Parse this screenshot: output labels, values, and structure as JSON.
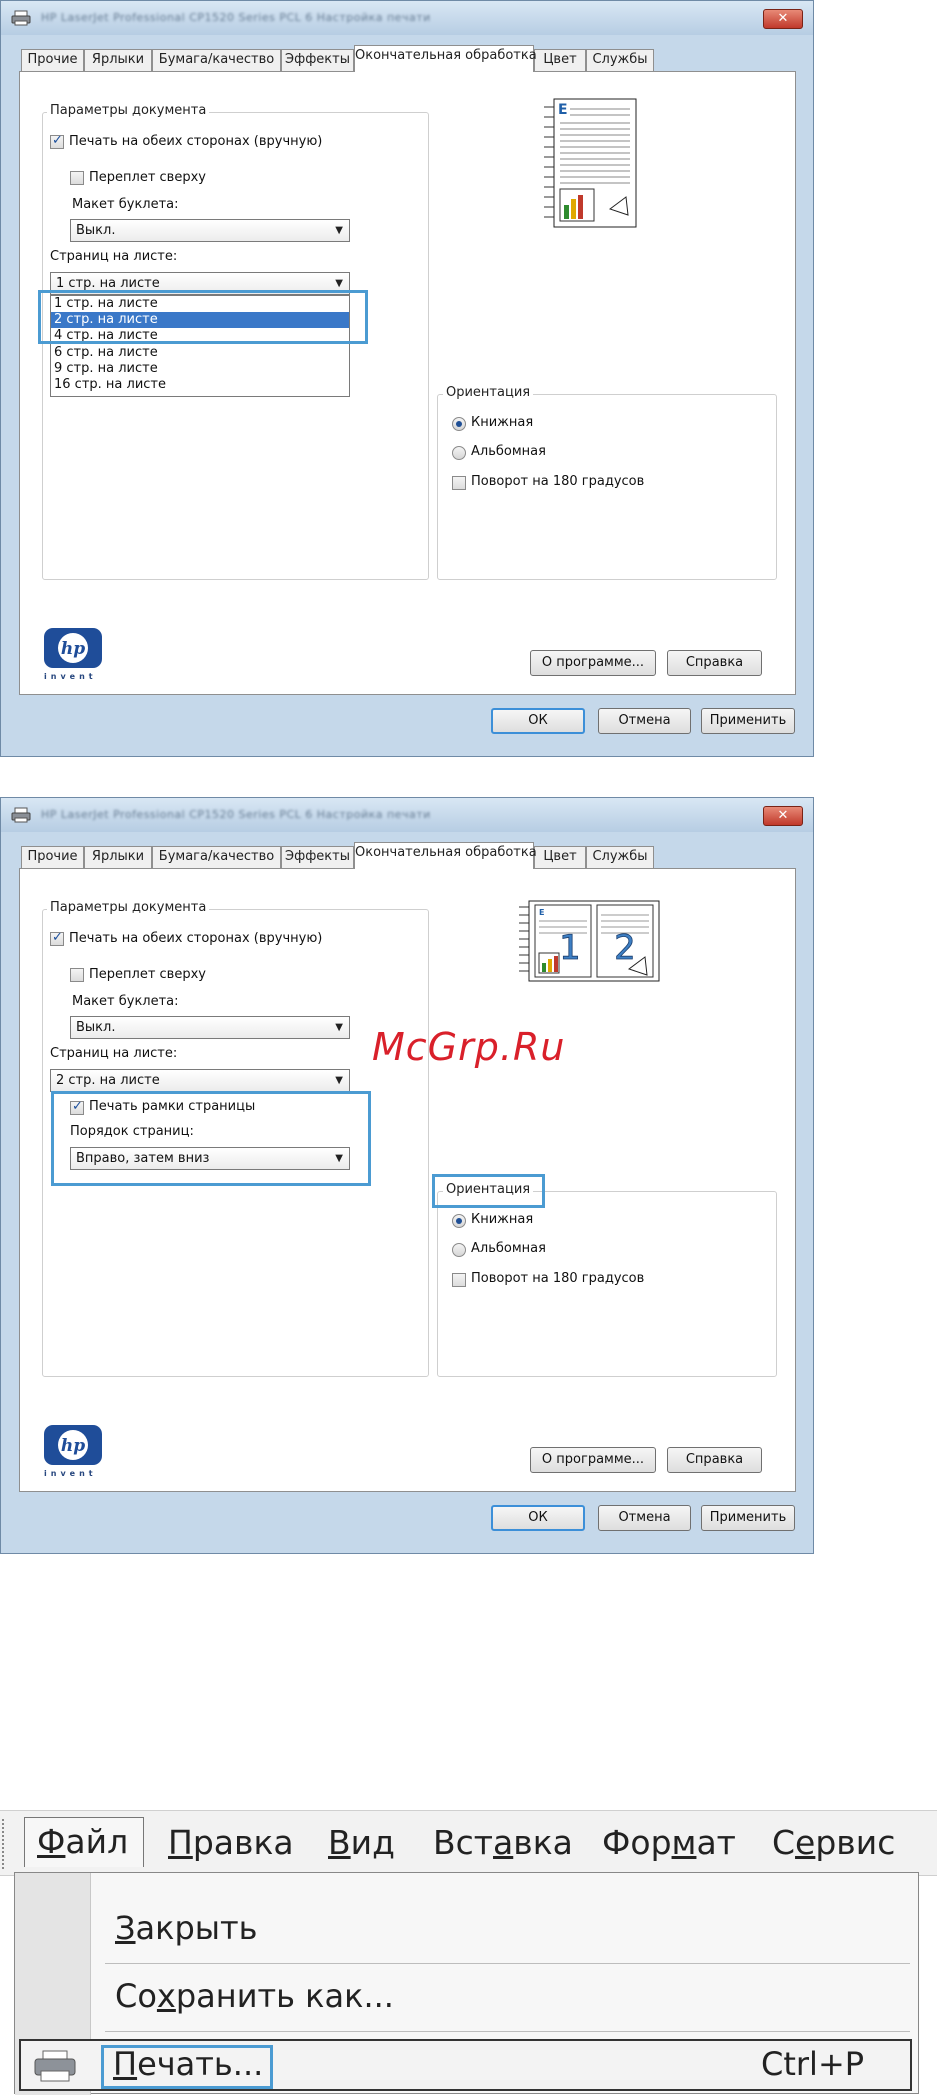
{
  "colors": {
    "highlight": "#4b9bd2",
    "selected_option": "#3a78c8",
    "watermark": "#d9202a"
  },
  "dialog": {
    "title": "HP LaserJet Professional CP1520 Series PCL 6 Настройка печати",
    "close_label": "✕",
    "tabs": [
      "Прочие",
      "Ярлыки",
      "Бумага/качество",
      "Эффекты",
      "Окончательная обработка",
      "Цвет",
      "Службы"
    ],
    "active_tab": "Окончательная обработка",
    "doc_options_legend": "Параметры документа",
    "duplex_label": "Печать на обеих сторонах (вручную)",
    "flip_up_label": "Переплет сверху",
    "booklet_label": "Макет буклета:",
    "booklet_value": "Выкл.",
    "pages_per_sheet_label": "Страниц на листе:",
    "orientation_legend": "Ориентация",
    "portrait_label": "Книжная",
    "landscape_label": "Альбомная",
    "rotate_label": "Поворот на 180 градусов",
    "about_button": "О программе...",
    "help_button": "Справка",
    "ok_button": "ОК",
    "cancel_button": "Отмена",
    "apply_button": "Применить",
    "hp_invent": "invent"
  },
  "dialog1": {
    "pages_per_sheet_value": "1 стр. на листе",
    "pages_options": [
      "1 стр. на листе",
      "2 стр. на листе",
      "4 стр. на листе",
      "6 стр. на листе",
      "9 стр. на листе",
      "16 стр. на листе"
    ],
    "selected_option": "2 стр. на листе"
  },
  "dialog2": {
    "pages_per_sheet_value": "2 стр. на листе",
    "print_borders_label": "Печать рамки страницы",
    "page_order_label": "Порядок страниц:",
    "page_order_value": "Вправо, затем вниз",
    "preview_page_numbers": [
      "1",
      "2"
    ]
  },
  "watermark": "McGrp.Ru",
  "menu": {
    "items": [
      {
        "label_pre": "",
        "mnemonic": "Ф",
        "label_post": "айл"
      },
      {
        "label_pre": "",
        "mnemonic": "П",
        "label_post": "равка"
      },
      {
        "label_pre": "",
        "mnemonic": "В",
        "label_post": "ид"
      },
      {
        "label_pre": "Вст",
        "mnemonic": "а",
        "label_post": "вка"
      },
      {
        "label_pre": "Фор",
        "mnemonic": "м",
        "label_post": "ат"
      },
      {
        "label_pre": "С",
        "mnemonic": "е",
        "label_post": "рвис"
      }
    ],
    "dropdown": {
      "close": {
        "mnemonic": "З",
        "rest": "акрыть"
      },
      "save_as": {
        "pre": "Со",
        "mnemonic": "х",
        "post": "ранить как..."
      },
      "print": {
        "mnemonic": "П",
        "rest": "ечать..."
      },
      "print_shortcut": "Ctrl+P"
    }
  }
}
